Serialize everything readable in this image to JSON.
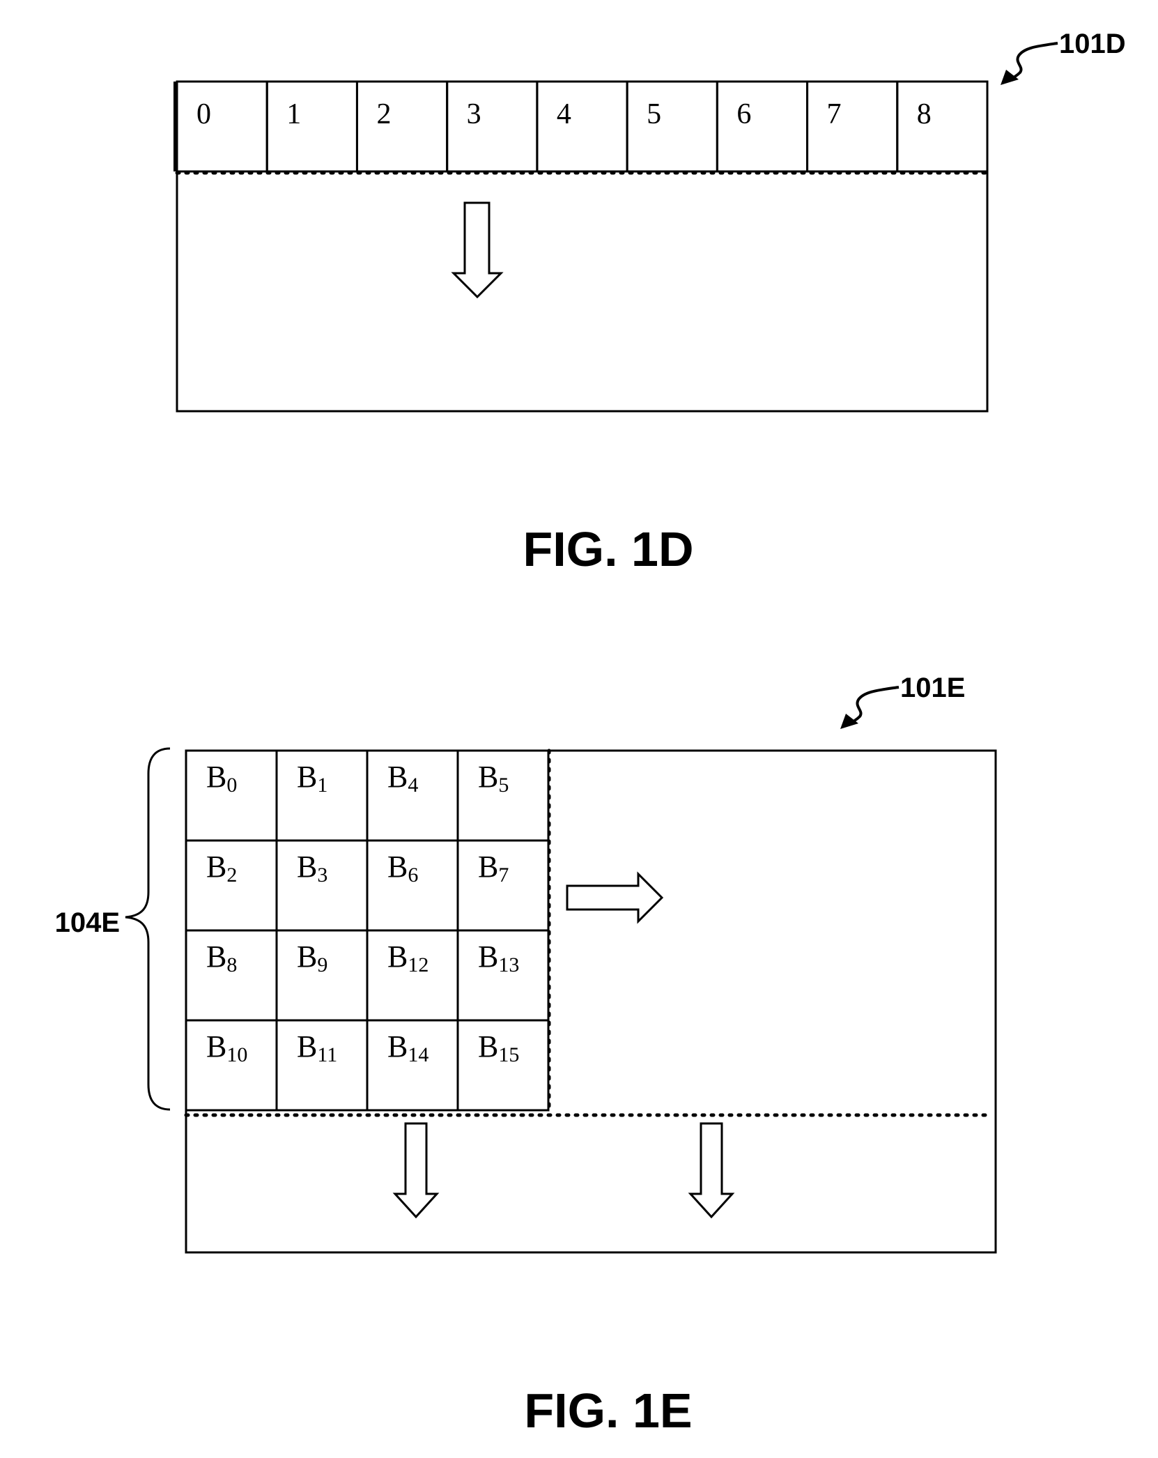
{
  "figures": [
    {
      "id": "fig-1d",
      "caption": "FIG. 1D",
      "reference_label": "101D",
      "header_cells": [
        "0",
        "1",
        "2",
        "3",
        "4",
        "5",
        "6",
        "7",
        "8"
      ],
      "arrows": [
        "down"
      ]
    },
    {
      "id": "fig-1e",
      "caption": "FIG. 1E",
      "reference_label": "101E",
      "bracket_label": "104E",
      "block_prefix": "B",
      "block_grid": [
        [
          "0",
          "1",
          "4",
          "5"
        ],
        [
          "2",
          "3",
          "6",
          "7"
        ],
        [
          "8",
          "9",
          "12",
          "13"
        ],
        [
          "10",
          "11",
          "14",
          "15"
        ]
      ],
      "arrows": [
        "right",
        "down",
        "down"
      ]
    }
  ],
  "colors": {
    "stroke": "#000000",
    "background": "#ffffff"
  }
}
